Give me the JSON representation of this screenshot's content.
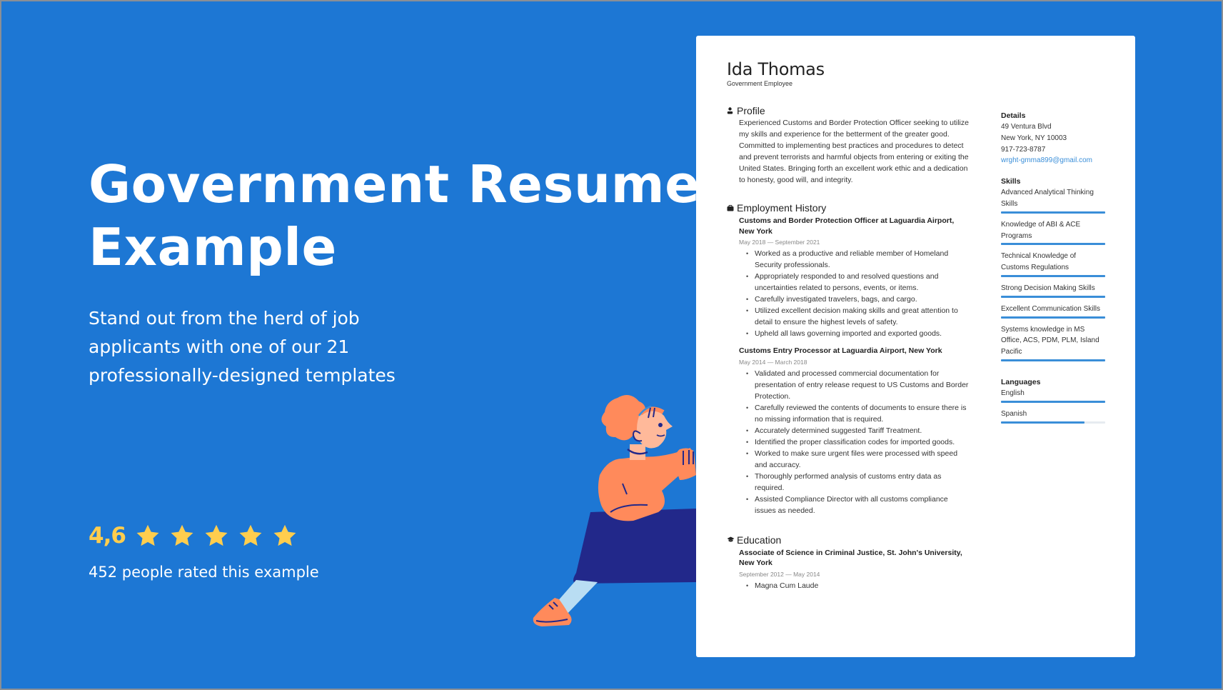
{
  "hero": {
    "title": "Government Resume Example",
    "subtitle": "Stand out from the herd of job applicants with one of our 21 professionally-designed templates",
    "rating_value": "4,6",
    "stars": 5,
    "rating_count": "452 people rated this example"
  },
  "colors": {
    "background": "#1D77D4",
    "star": "#FFCD4E",
    "accent_bar": "#3A8ED8",
    "link": "#3B8FD9"
  },
  "resume": {
    "name": "Ida Thomas",
    "job_title": "Government Employee",
    "profile": {
      "heading": "Profile",
      "icon": "person-icon",
      "text": "Experienced Customs and Border Protection Officer seeking to utilize my skills and experience for the betterment of the greater good. Committed to implementing best practices and procedures to detect and prevent terrorists and harmful objects from entering or exiting the United States. Bringing forth an excellent work ethic and a dedication to honesty, good will, and integrity."
    },
    "employment": {
      "heading": "Employment History",
      "icon": "briefcase-icon",
      "jobs": [
        {
          "title": "Customs and Border Protection Officer at Laguardia Airport, New York",
          "dates": "May 2018 — September 2021",
          "bullets": [
            "Worked as a productive and reliable member of Homeland Security professionals.",
            "Appropriately responded to and resolved questions and uncertainties related to persons, events, or items.",
            "Carefully investigated travelers, bags, and cargo.",
            "Utilized excellent decision making skills and great attention to detail to ensure the highest levels of safety.",
            "Upheld all laws governing imported and exported goods."
          ]
        },
        {
          "title": "Customs Entry Processor at Laguardia Airport, New York",
          "dates": "May 2014 — March 2018",
          "bullets": [
            "Validated and processed commercial documentation for presentation of entry release request to US Customs and Border Protection.",
            "Carefully reviewed the contents of documents to ensure there is no missing information that is required.",
            "Accurately determined suggested Tariff Treatment.",
            "Identified the proper classification codes for imported goods.",
            "Worked to make sure urgent files were processed with speed and accuracy.",
            "Thoroughly performed analysis of customs entry data as required.",
            "Assisted Compliance Director with all customs compliance issues as needed."
          ]
        }
      ]
    },
    "education": {
      "heading": "Education",
      "icon": "graduation-cap-icon",
      "items": [
        {
          "title": "Associate of Science in Criminal Justice, St. John's University, New York",
          "dates": "September 2012 — May 2014",
          "bullets": [
            "Magna Cum Laude"
          ]
        }
      ]
    },
    "details": {
      "heading": "Details",
      "address_line1": "49 Ventura Blvd",
      "address_line2": "New York, NY 10003",
      "phone": "917-723-8787",
      "email": "wrght-gmma899@gmail.com"
    },
    "skills": {
      "heading": "Skills",
      "items": [
        {
          "label": "Advanced Analytical Thinking Skills",
          "level": 1.0
        },
        {
          "label": "Knowledge of ABI & ACE Programs",
          "level": 1.0
        },
        {
          "label": "Technical Knowledge of Customs Regulations",
          "level": 1.0
        },
        {
          "label": "Strong Decision Making Skills",
          "level": 1.0
        },
        {
          "label": "Excellent Communication Skills",
          "level": 1.0
        },
        {
          "label": "Systems knowledge in MS Office, ACS, PDM, PLM, Island Pacific",
          "level": 1.0
        }
      ]
    },
    "languages": {
      "heading": "Languages",
      "items": [
        {
          "label": "English",
          "level": 1.0
        },
        {
          "label": "Spanish",
          "level": 0.8
        }
      ]
    }
  }
}
